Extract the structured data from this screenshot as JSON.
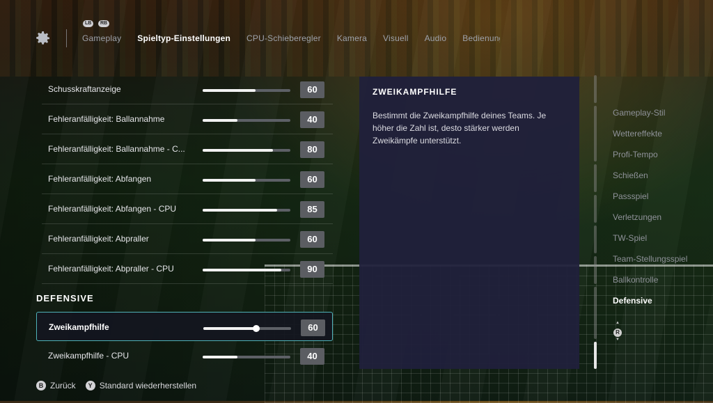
{
  "header": {
    "bumper_left": "LB",
    "bumper_right": "RB",
    "tabs": [
      {
        "label": "Gameplay"
      },
      {
        "label": "Spieltyp-Einstellungen"
      },
      {
        "label": "CPU-Schieberegler"
      },
      {
        "label": "Kamera"
      },
      {
        "label": "Visuell"
      },
      {
        "label": "Audio"
      },
      {
        "label": "Bedienung"
      }
    ],
    "active_tab": "Spieltyp-Einstellungen"
  },
  "settings": {
    "rows": [
      {
        "label": "Schusskraftanzeige",
        "value": "60",
        "level": 0.6
      },
      {
        "label": "Fehleranfälligkeit: Ballannahme",
        "value": "40",
        "level": 0.4
      },
      {
        "label": "Fehleranfälligkeit: Ballannahme - C...",
        "value": "80",
        "level": 0.8
      },
      {
        "label": "Fehleranfälligkeit: Abfangen",
        "value": "60",
        "level": 0.6
      },
      {
        "label": "Fehleranfälligkeit: Abfangen - CPU",
        "value": "85",
        "level": 0.85
      },
      {
        "label": "Fehleranfälligkeit: Abpraller",
        "value": "60",
        "level": 0.6
      },
      {
        "label": "Fehleranfälligkeit: Abpraller - CPU",
        "value": "90",
        "level": 0.9
      }
    ],
    "section_title": "DEFENSIVE",
    "defensive_rows": [
      {
        "label": "Zweikampfhilfe",
        "value": "60",
        "level": 0.6,
        "selected": true
      },
      {
        "label": "Zweikampfhilfe - CPU",
        "value": "40",
        "level": 0.4,
        "selected": false
      }
    ]
  },
  "description": {
    "title": "ZWEIKAMPFHILFE",
    "text": "Bestimmt die Zweikampfhilfe deines Teams. Je höher die Zahl ist, desto stärker werden Zweikämpfe unterstützt."
  },
  "category_nav": {
    "items": [
      {
        "label": "Gameplay-Stil"
      },
      {
        "label": "Wettereffekte"
      },
      {
        "label": "Profi-Tempo"
      },
      {
        "label": "Schießen"
      },
      {
        "label": "Passspiel"
      },
      {
        "label": "Verletzungen"
      },
      {
        "label": "TW-Spiel"
      },
      {
        "label": "Team-Stellungsspiel"
      },
      {
        "label": "Ballkontrolle"
      },
      {
        "label": "Defensive"
      }
    ],
    "active": "Defensive",
    "stick_label": "R"
  },
  "footer": {
    "back": {
      "button": "B",
      "label": "Zurück"
    },
    "reset": {
      "button": "Y",
      "label": "Standard wiederherstellen"
    }
  },
  "colors": {
    "accent": "#4fb3b8",
    "panel": "#20203c",
    "value_box": "#5b5d62"
  }
}
